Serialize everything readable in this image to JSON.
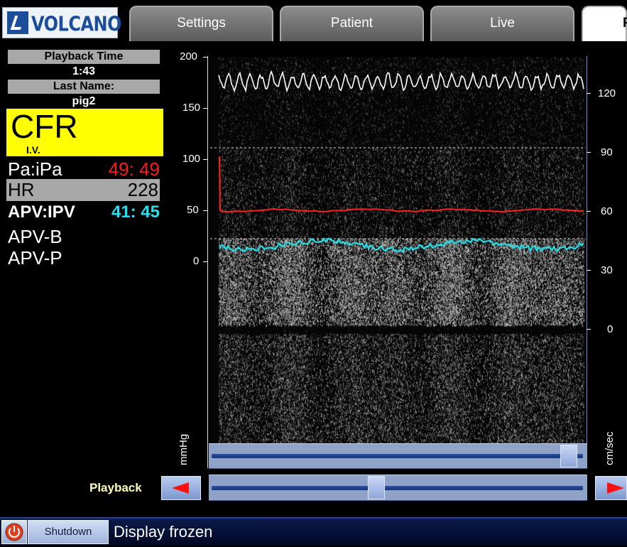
{
  "logo": {
    "text": "VOLCANO"
  },
  "tabs": [
    {
      "label": "Settings"
    },
    {
      "label": "Patient"
    },
    {
      "label": "Live"
    },
    {
      "label": "P"
    }
  ],
  "left_panel": {
    "playback_time_label": "Playback Time",
    "playback_time_value": "1:43",
    "last_name_label": "Last Name:",
    "last_name_value": "pig2",
    "cfr_label": "CFR",
    "cfr_sub": "I.V.",
    "pa_ipa_label": "Pa:iPa",
    "pa_ipa_value": "49: 49",
    "hr_label": "HR",
    "hr_value": "228",
    "apv_ipv_label": "APV:IPV",
    "apv_ipv_value": "41: 45",
    "apv_b_label": "APV-B",
    "apv_p_label": "APV-P"
  },
  "chart": {
    "left_axis_ticks": [
      "200",
      "150",
      "100",
      "50",
      "0"
    ],
    "left_axis_unit": "mmHg",
    "right_axis_ticks": [
      "120",
      "90",
      "60",
      "30",
      "0"
    ],
    "right_axis_unit": "cm/sec",
    "colors": {
      "pressure": "#ff2020",
      "velocity": "#20e0e8",
      "ecg": "#ffffff",
      "hr_text": "#ff1a1a",
      "apv_text": "#22e0ee",
      "cfr_bg": "#ffff00"
    }
  },
  "scroll_slider": {
    "position": 0.98
  },
  "playback": {
    "label": "Playback",
    "position": 0.44
  },
  "bottom": {
    "shutdown_label": "Shutdown",
    "status_text": "Display frozen"
  }
}
